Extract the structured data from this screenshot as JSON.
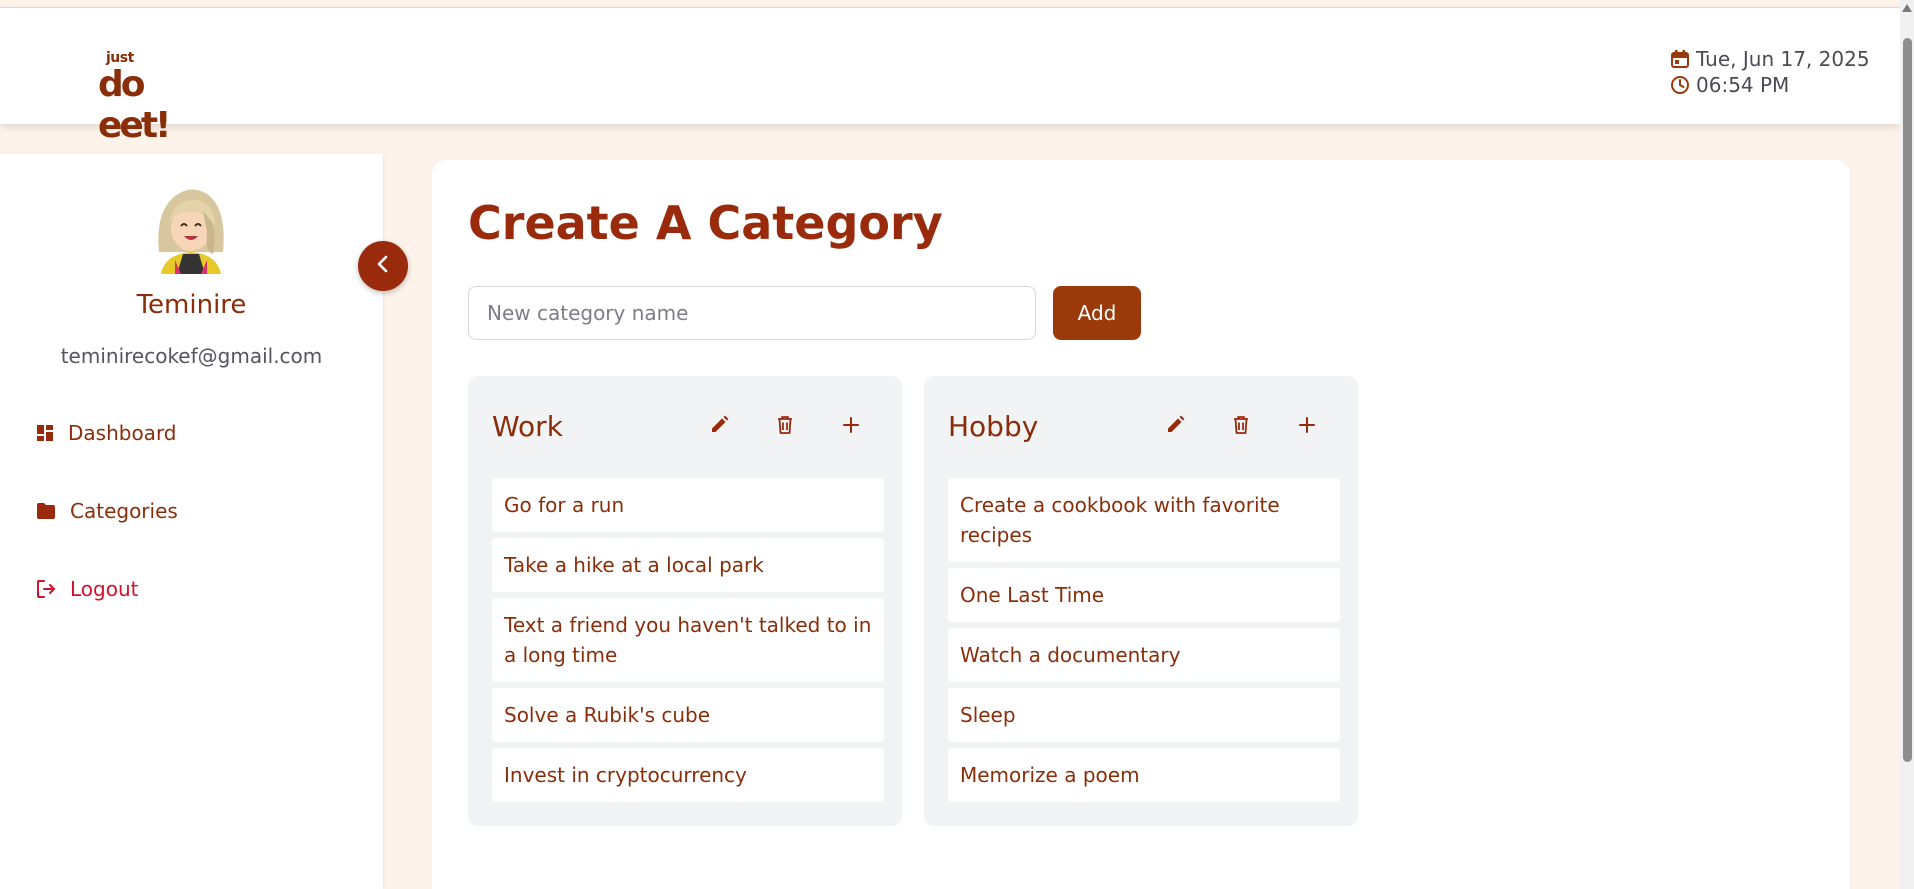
{
  "app": {
    "logo_small": "just",
    "logo_big": "do eet!"
  },
  "header": {
    "date": "Tue, Jun 17, 2025",
    "time": "06:54 PM"
  },
  "sidebar": {
    "user_name": "Teminire",
    "user_email": "teminirecokef@gmail.com",
    "items": [
      {
        "label": "Dashboard",
        "icon": "dashboard-icon"
      },
      {
        "label": "Categories",
        "icon": "folder-icon"
      },
      {
        "label": "Logout",
        "icon": "logout-icon"
      }
    ]
  },
  "main": {
    "title": "Create A Category",
    "input_placeholder": "New category name",
    "input_value": "",
    "add_label": "Add",
    "categories": [
      {
        "name": "Work",
        "tasks": [
          "Go for a run",
          "Take a hike at a local park",
          "Text a friend you haven't talked to in a long time",
          "Solve a Rubik's cube",
          "Invest in cryptocurrency"
        ]
      },
      {
        "name": "Hobby",
        "tasks": [
          "Create a cookbook with favorite recipes",
          "One Last Time",
          "Watch a documentary",
          "Sleep",
          "Memorize a poem"
        ]
      }
    ]
  },
  "colors": {
    "brand": "#9a2a0c",
    "logout": "#d4102c",
    "background": "#fdf3ea",
    "card": "#f2f3f5"
  }
}
